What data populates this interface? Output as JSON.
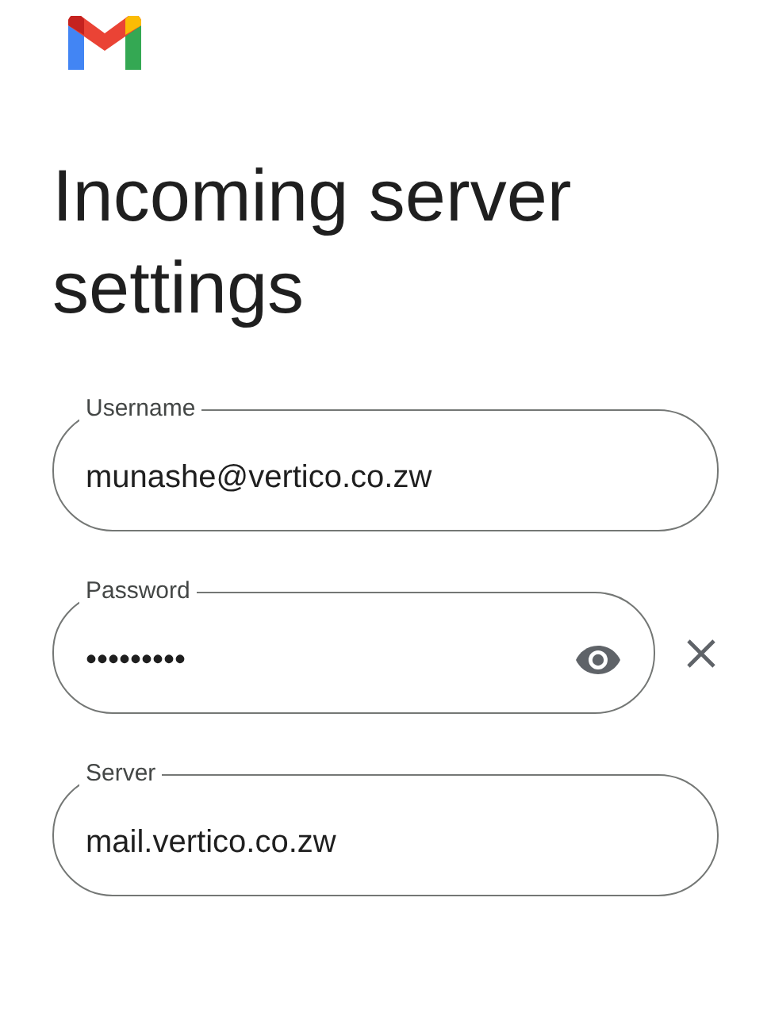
{
  "title": "Incoming server settings",
  "fields": [
    {
      "kind": "text",
      "label": "Username",
      "value": "munashe@vertico.co.zw"
    },
    {
      "kind": "password",
      "label": "Password",
      "value": "•••••••••"
    },
    {
      "kind": "text",
      "label": "Server",
      "value": "mail.vertico.co.zw"
    }
  ]
}
